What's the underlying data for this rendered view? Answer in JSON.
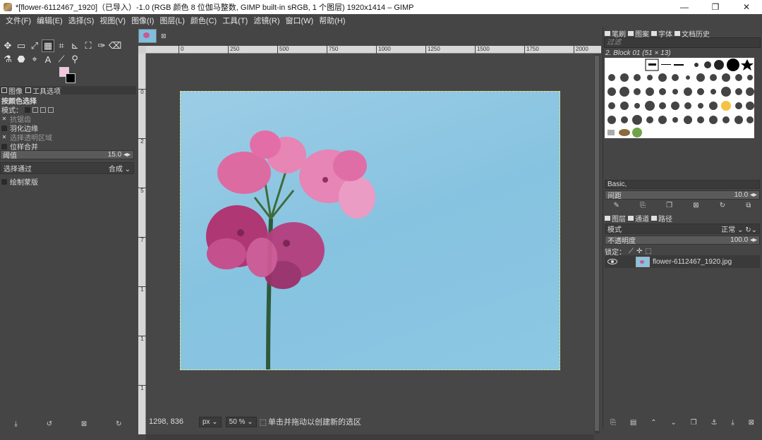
{
  "window": {
    "title": "*[flower-6112467_1920]（已导入）-1.0 (RGB 颜色 8 位伽马整数, GIMP built-in sRGB, 1 个图层) 1920x1414 – GIMP",
    "min": "—",
    "restore": "❐",
    "close": "✕"
  },
  "menu": [
    "文件(F)",
    "编辑(E)",
    "选择(S)",
    "视图(V)",
    "图像(I)",
    "图层(L)",
    "颜色(C)",
    "工具(T)",
    "滤镜(R)",
    "窗口(W)",
    "帮助(H)"
  ],
  "toolbox": {
    "row1": [
      "✥",
      "▭",
      "⤢",
      "▦",
      "⌗",
      "⊾",
      "⛶",
      "✑",
      "⌫"
    ],
    "row2": [
      "⚗",
      "⬣",
      "⌖",
      "A",
      "⟋",
      "⚲"
    ],
    "fg_color": "#f3c6de",
    "bg_color": "#000000"
  },
  "tool_options": {
    "tabs": [
      "图像",
      "工具选项"
    ],
    "tool_name": "按颜色选择",
    "mode_label": "模式：",
    "antialias": "抗锯齿",
    "feather": "羽化边缘",
    "select_transparent": "选择透明区域",
    "sample_merged": "位样合并",
    "threshold_label": "阈值",
    "threshold_value": "15.0",
    "select_by_label": "选择通过",
    "select_by_value": "合成",
    "draw_mask": "绘制蒙版"
  },
  "image_tab": {
    "close": "⊠"
  },
  "rulers": {
    "h": [
      "0",
      "250",
      "500",
      "750",
      "1000",
      "1250",
      "1500",
      "1750",
      "2000"
    ],
    "v": [
      "0",
      "2",
      "5",
      "7",
      "1",
      "1",
      "1"
    ]
  },
  "status": {
    "coords": "1298, 836",
    "unit": "px",
    "zoom": "50 %",
    "message": "单击并拖动以创建新的选区"
  },
  "right_dock": {
    "tabs1": [
      "笔刷",
      "图案",
      "字体",
      "文档历史"
    ],
    "filter_placeholder": "过滤",
    "brush_name": "2. Block 01 (51 × 13)",
    "preset": "Basic,",
    "spacing_label": "间距",
    "spacing_value": "10.0",
    "tabs2": [
      "图层",
      "通道",
      "路径"
    ],
    "mode_label": "模式",
    "mode_value": "正常",
    "opacity_label": "不透明度",
    "opacity_value": "100.0",
    "lock_label": "锁定：",
    "layer_name": "flower-6112467_1920.jpg"
  }
}
